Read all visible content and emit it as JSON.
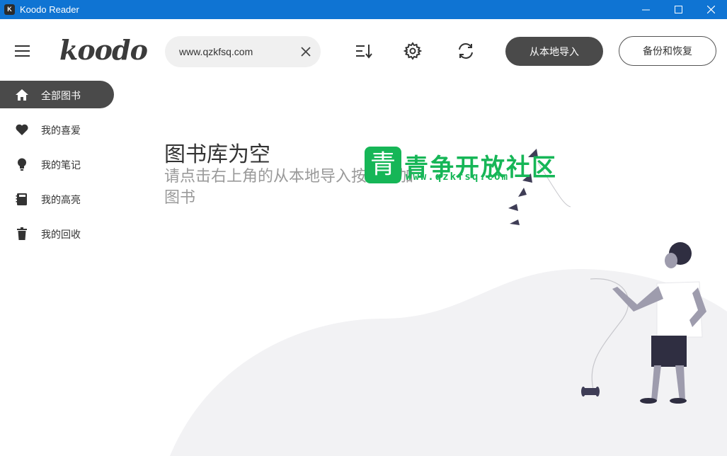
{
  "window": {
    "title": "Koodo Reader",
    "app_icon_glyph": "K",
    "controls": [
      "minimize-icon",
      "maximize-icon",
      "close-icon"
    ]
  },
  "header": {
    "logo": "koodo",
    "search": {
      "value": "www.qzkfsq.com",
      "placeholder": ""
    },
    "icons": [
      "hamburger-menu-icon",
      "sort-icon",
      "gear-icon",
      "sync-icon",
      "clear-icon"
    ],
    "import_label": "从本地导入",
    "backup_label": "备份和恢复"
  },
  "sidebar": {
    "items": [
      {
        "label": "全部图书",
        "icon": "home-icon",
        "active": true
      },
      {
        "label": "我的喜爱",
        "icon": "heart-icon",
        "active": false
      },
      {
        "label": "我的笔记",
        "icon": "lightbulb-icon",
        "active": false
      },
      {
        "label": "我的高亮",
        "icon": "notebook-icon",
        "active": false
      },
      {
        "label": "我的回收",
        "icon": "trash-icon",
        "active": false
      }
    ]
  },
  "empty_state": {
    "title": "图书库为空",
    "subtitle_line1": "请点击右上角的从本地导入按钮添加",
    "subtitle_line2": "图书"
  },
  "watermark": {
    "glyph": "青",
    "text": "青争开放社区",
    "url": "www.qzkfsq.com"
  },
  "colors": {
    "titlebar": "#0f74d3",
    "active_nav": "#4a4a4a",
    "primary_button": "#4a4a4a",
    "watermark_green": "#16b657"
  }
}
